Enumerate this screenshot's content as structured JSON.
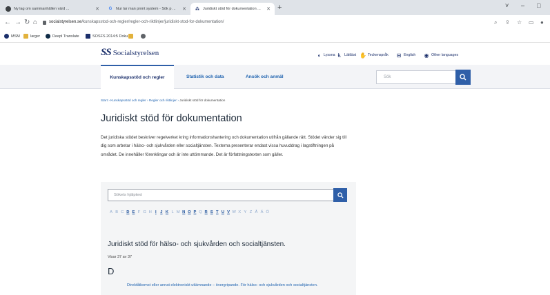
{
  "browser": {
    "tabs": [
      {
        "title": "Ny lag om sammanhållen värd ...",
        "active": false
      },
      {
        "title": "Nur lar man pnmt system - Sök p ...",
        "active": false
      },
      {
        "title": "Juridiskt stöd för dokumentation ...",
        "active": true
      }
    ],
    "new_tab": "+",
    "url_host": "socialstyrelsen.se",
    "url_path": "/kunskapsstod-och-regler/regler-och-riktlinjer/juridiskt-stod-for-dokumentation/",
    "bookmarks": [
      "MSM",
      "larger",
      "Deepl Translate",
      "SOSFS 2014:5 Doku...",
      ""
    ],
    "window_controls": [
      "˅",
      "–",
      "□"
    ]
  },
  "site": {
    "logo_text": "Socialstyrelsen",
    "utility": [
      "Lyssna",
      "Lättläst",
      "Teckenspråk",
      "English",
      "Other languages"
    ],
    "nav": [
      {
        "label": "Kunskapsstöd och regler",
        "active": true
      },
      {
        "label": "Statistik och data",
        "active": false
      },
      {
        "label": "Ansök och anmäl",
        "active": false
      }
    ],
    "search_placeholder": "Sök"
  },
  "content": {
    "breadcrumb": [
      "Start",
      "Kunskapsstöd och regler",
      "Regler och riktlinjer"
    ],
    "breadcrumb_current": "Juridiskt stöd för dokumentation",
    "title": "Juridiskt stöd för dokumentation",
    "intro": "Det juridiska stödet beskriver regelverket kring informationshantering och dokumentation utifrån gällande rätt. Stödet vänder sig till dig som arbetar i hälso- och sjukvården eller socialtjänsten. Texterna presenterar endast vissa huvuddrag i lagstiftningen på området. De innehåller förenklingar och är inte uttömmande. Det är författningstexten som gäller.",
    "panel": {
      "search_placeholder": "Sökets hjälptext",
      "alphabet": [
        {
          "l": "A",
          "on": false
        },
        {
          "l": "B",
          "on": false
        },
        {
          "l": "C",
          "on": false
        },
        {
          "l": "D",
          "on": true
        },
        {
          "l": "E",
          "on": true
        },
        {
          "l": "F",
          "on": false
        },
        {
          "l": "G",
          "on": false
        },
        {
          "l": "H",
          "on": false
        },
        {
          "l": "I",
          "on": true
        },
        {
          "l": "J",
          "on": true
        },
        {
          "l": "K",
          "on": true
        },
        {
          "l": "L",
          "on": false
        },
        {
          "l": "M",
          "on": false
        },
        {
          "l": "N",
          "on": true
        },
        {
          "l": "O",
          "on": true
        },
        {
          "l": "P",
          "on": true
        },
        {
          "l": "Q",
          "on": false
        },
        {
          "l": "R",
          "on": true
        },
        {
          "l": "S",
          "on": true
        },
        {
          "l": "T",
          "on": true
        },
        {
          "l": "U",
          "on": true
        },
        {
          "l": "V",
          "on": true
        },
        {
          "l": "W",
          "on": false
        },
        {
          "l": "X",
          "on": false
        },
        {
          "l": "Y",
          "on": false
        },
        {
          "l": "Z",
          "on": false
        },
        {
          "l": "Å",
          "on": false
        },
        {
          "l": "Ä",
          "on": false
        },
        {
          "l": "Ö",
          "on": false
        }
      ],
      "section_title": "Juridiskt stöd för hälso- och sjukvården och socialtjänsten.",
      "count": "Visar 37 av 37",
      "letter": "D",
      "entry": "Direktåtkomst eller annat elektroniskt utlämnande – övergripande. För hälso- och sjukvården och socialtjänsten."
    }
  },
  "colors": {
    "brand": "#1b2f6b",
    "accent": "#2f5fa8",
    "link": "#2164b0"
  }
}
